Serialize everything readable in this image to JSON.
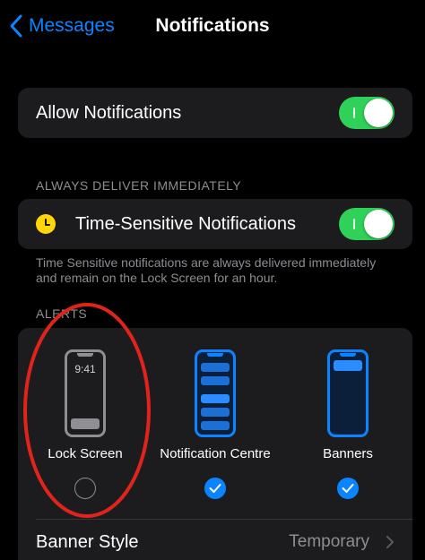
{
  "nav": {
    "back_label": "Messages",
    "title": "Notifications"
  },
  "allow": {
    "label": "Allow Notifications",
    "enabled": true
  },
  "deliver": {
    "header": "ALWAYS DELIVER IMMEDIATELY",
    "label": "Time-Sensitive Notifications",
    "enabled": true,
    "footnote": "Time Sensitive notifications are always delivered immediately and remain on the Lock Screen for an hour."
  },
  "alerts": {
    "header": "ALERTS",
    "options": [
      {
        "label": "Lock Screen",
        "checked": false,
        "phone_time": "9:41"
      },
      {
        "label": "Notification Centre",
        "checked": true
      },
      {
        "label": "Banners",
        "checked": true
      }
    ],
    "banner_style": {
      "label": "Banner Style",
      "value": "Temporary"
    }
  },
  "colors": {
    "accent": "#0a84ff",
    "toggle_on": "#30d158",
    "annotation": "#e0241b",
    "clock": "#ffd60a"
  },
  "icons": [
    "chevron-left-icon",
    "clock-icon",
    "checkmark-icon",
    "chevron-right-icon"
  ]
}
